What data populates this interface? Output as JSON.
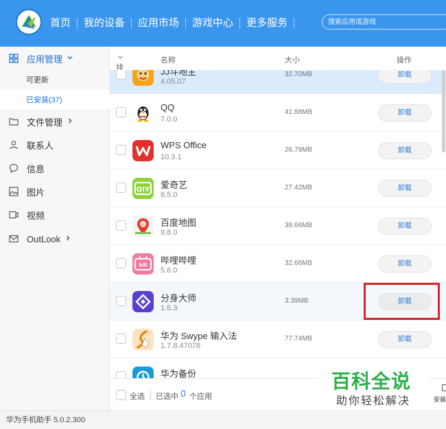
{
  "header": {
    "nav": [
      {
        "label": "首页"
      },
      {
        "label": "我的设备",
        "active": true
      },
      {
        "label": "应用市场"
      },
      {
        "label": "游戏中心"
      },
      {
        "label": "更多服务"
      }
    ],
    "search_placeholder": "搜索应用或游戏",
    "accent_color": "#3a95ec"
  },
  "sidebar": {
    "app_manage": "应用管理",
    "updatable": "可更新",
    "installed": "已安装(37)",
    "file_manage": "文件管理",
    "contacts": "联系人",
    "messages": "信息",
    "pictures": "图片",
    "videos": "视频",
    "outlook": "OutLook"
  },
  "table": {
    "col_sort": "排序",
    "col_name": "名称",
    "col_size": "大小",
    "col_action": "操作",
    "action_label": "卸载",
    "rows": [
      {
        "name": "JJ斗地主",
        "version": "4.05.07",
        "size": "32.70MB",
        "icon": "jj-landlord-icon"
      },
      {
        "name": "QQ",
        "version": "7.0.0",
        "size": "41.88MB",
        "icon": "qq-penguin-icon"
      },
      {
        "name": "WPS Office",
        "version": "10.3.1",
        "size": "26.79MB",
        "icon": "wps-office-icon"
      },
      {
        "name": "爱奇艺",
        "version": "8.5.0",
        "size": "27.42MB",
        "icon": "iqiyi-icon"
      },
      {
        "name": "百度地图",
        "version": "9.8.0",
        "size": "39.66MB",
        "icon": "baidu-map-icon"
      },
      {
        "name": "哔哩哔哩",
        "version": "5.6.0",
        "size": "32.66MB",
        "icon": "bilibili-icon"
      },
      {
        "name": "分身大师",
        "version": "1.6.3",
        "size": "3.39MB",
        "icon": "clone-master-icon"
      },
      {
        "name": "华为 Swype 输入法",
        "version": "1.7.8.47078",
        "size": "77.74MB",
        "icon": "swype-icon"
      },
      {
        "name": "华为备份",
        "version": "",
        "size": "",
        "icon": "huawei-backup-icon"
      }
    ]
  },
  "footer": {
    "select_all": "全选",
    "selected_prefix": "已选中",
    "selected_count": "0",
    "selected_suffix": "个应用"
  },
  "watermark": {
    "title": "百科全说",
    "subtitle": "助你轻松解决",
    "side_text": "安装"
  },
  "statusbar": {
    "version_text": "华为手机助手 5.0.2.300"
  }
}
